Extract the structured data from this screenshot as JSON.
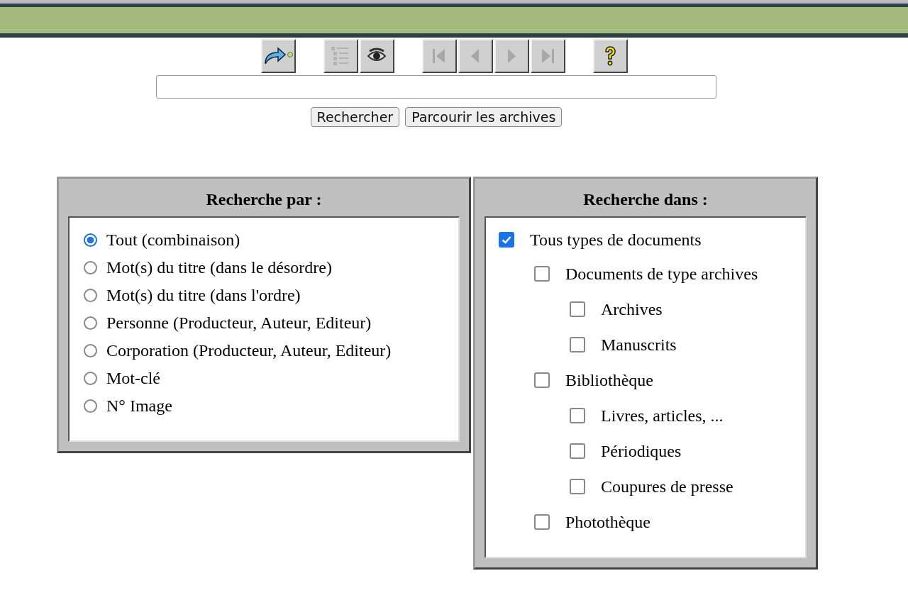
{
  "toolbar": [
    {
      "kind": "export",
      "disabled": false
    },
    {
      "kind": "list",
      "disabled": true
    },
    {
      "kind": "eye",
      "disabled": false
    },
    {
      "kind": "first",
      "disabled": true
    },
    {
      "kind": "prev",
      "disabled": true
    },
    {
      "kind": "next",
      "disabled": true
    },
    {
      "kind": "last",
      "disabled": true
    },
    {
      "kind": "help",
      "disabled": false
    }
  ],
  "buttons": [
    "Rechercher",
    "Parcourir les archives"
  ],
  "search_by": {
    "title": "Recherche par :",
    "options": [
      {
        "label": "Tout (combinaison)",
        "selected": true
      },
      {
        "label": "Mot(s) du titre (dans le désordre)",
        "selected": false
      },
      {
        "label": "Mot(s) du titre (dans l'ordre)",
        "selected": false
      },
      {
        "label": "Personne (Producteur, Auteur, Editeur)",
        "selected": false
      },
      {
        "label": "Corporation (Producteur, Auteur, Editeur)",
        "selected": false
      },
      {
        "label": "Mot-clé",
        "selected": false
      },
      {
        "label": "N° Image",
        "selected": false
      }
    ]
  },
  "search_in": {
    "title": "Recherche dans :",
    "items": [
      {
        "label": "Tous types de documents",
        "checked": true,
        "children": [
          {
            "label": "Documents de type archives",
            "checked": false,
            "children": [
              {
                "label": "Archives",
                "checked": false
              },
              {
                "label": "Manuscrits",
                "checked": false
              }
            ]
          },
          {
            "label": "Bibliothèque",
            "checked": false,
            "children": [
              {
                "label": "Livres, articles, ...",
                "checked": false
              },
              {
                "label": "Périodiques",
                "checked": false
              },
              {
                "label": "Coupures de presse",
                "checked": false
              }
            ]
          },
          {
            "label": "Photothèque",
            "checked": false
          }
        ]
      }
    ]
  }
}
